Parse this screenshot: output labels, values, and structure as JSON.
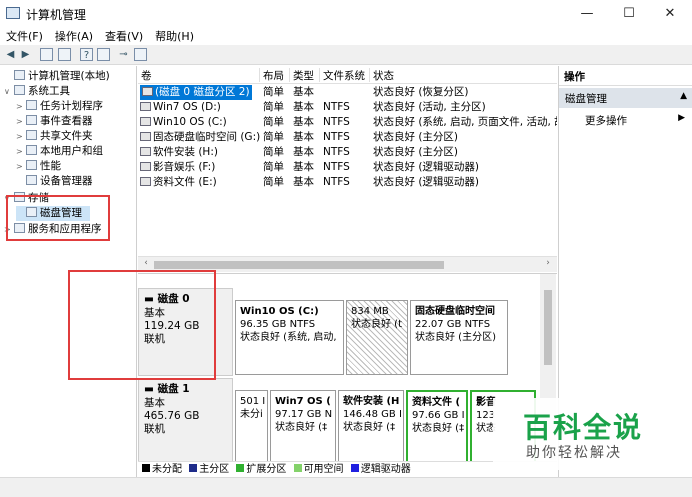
{
  "window": {
    "title": "计算机管理",
    "minimize": "—",
    "maximize": "☐",
    "close": "✕"
  },
  "menu": [
    "文件(F)",
    "操作(A)",
    "查看(V)",
    "帮助(H)"
  ],
  "tree": [
    {
      "label": "计算机管理(本地)",
      "arrow": ""
    },
    {
      "label": "系统工具",
      "arrow": "∨"
    },
    {
      "label": "任务计划程序",
      "arrow": ">"
    },
    {
      "label": "事件查看器",
      "arrow": ">"
    },
    {
      "label": "共享文件夹",
      "arrow": ">"
    },
    {
      "label": "本地用户和组",
      "arrow": ">"
    },
    {
      "label": "性能",
      "arrow": ">"
    },
    {
      "label": "设备管理器",
      "arrow": ""
    },
    {
      "label": "存储",
      "arrow": "∨"
    },
    {
      "label": "磁盘管理",
      "arrow": ""
    },
    {
      "label": "服务和应用程序",
      "arrow": ">"
    }
  ],
  "volume_columns": [
    "卷",
    "布局",
    "类型",
    "文件系统",
    "状态"
  ],
  "volumes": [
    {
      "name": "(磁盘 0 磁盘分区 2)",
      "layout": "简单",
      "type": "基本",
      "fs": "",
      "status": "状态良好 (恢复分区)"
    },
    {
      "name": "Win7 OS (D:)",
      "layout": "简单",
      "type": "基本",
      "fs": "NTFS",
      "status": "状态良好 (活动, 主分区)"
    },
    {
      "name": "Win10 OS (C:)",
      "layout": "简单",
      "type": "基本",
      "fs": "NTFS",
      "status": "状态良好 (系统, 启动, 页面文件, 活动, 故"
    },
    {
      "name": "固态硬盘临时空间 (G:)",
      "layout": "简单",
      "type": "基本",
      "fs": "NTFS",
      "status": "状态良好 (主分区)"
    },
    {
      "name": "软件安装 (H:)",
      "layout": "简单",
      "type": "基本",
      "fs": "NTFS",
      "status": "状态良好 (主分区)"
    },
    {
      "name": "影音娱乐 (F:)",
      "layout": "简单",
      "type": "基本",
      "fs": "NTFS",
      "status": "状态良好 (逻辑驱动器)"
    },
    {
      "name": "资料文件 (E:)",
      "layout": "简单",
      "type": "基本",
      "fs": "NTFS",
      "status": "状态良好 (逻辑驱动器)"
    }
  ],
  "disks": [
    {
      "name": "磁盘 0",
      "type": "基本",
      "size": "119.24 GB",
      "state": "联机",
      "partitions": [
        {
          "name": "Win10 OS  (C:)",
          "size": "96.35 GB NTFS",
          "status": "状态良好 (系统, 启动,"
        },
        {
          "name": "",
          "size": "834 MB",
          "status": "状态良好 (t"
        },
        {
          "name": "固态硬盘临时空间",
          "size": "22.07 GB NTFS",
          "status": "状态良好 (主分区)"
        }
      ]
    },
    {
      "name": "磁盘 1",
      "type": "基本",
      "size": "465.76 GB",
      "state": "联机",
      "partitions": [
        {
          "name": "",
          "size": "501 I",
          "status": "未分i"
        },
        {
          "name": "Win7 OS  (",
          "size": "97.17 GB N",
          "status": "状态良好 (‡"
        },
        {
          "name": "软件安装 (H",
          "size": "146.48 GB I",
          "status": "状态良好 (‡"
        },
        {
          "name": "资料文件 (",
          "size": "97.66 GB I",
          "status": "状态良好 (‡"
        },
        {
          "name": "影音",
          "size": "123",
          "status": "状态"
        }
      ]
    }
  ],
  "legend": [
    {
      "label": "未分配",
      "color": "#000000"
    },
    {
      "label": "主分区",
      "color": "#1e2c8a"
    },
    {
      "label": "扩展分区",
      "color": "#30b030"
    },
    {
      "label": "可用空间",
      "color": "#84d26a"
    },
    {
      "label": "逻辑驱动器",
      "color": "#2020e0"
    }
  ],
  "actions": {
    "header": "操作",
    "section": "磁盘管理",
    "item": "更多操作"
  },
  "watermark": {
    "title": "百科全说",
    "subtitle": "助你轻松解决"
  }
}
